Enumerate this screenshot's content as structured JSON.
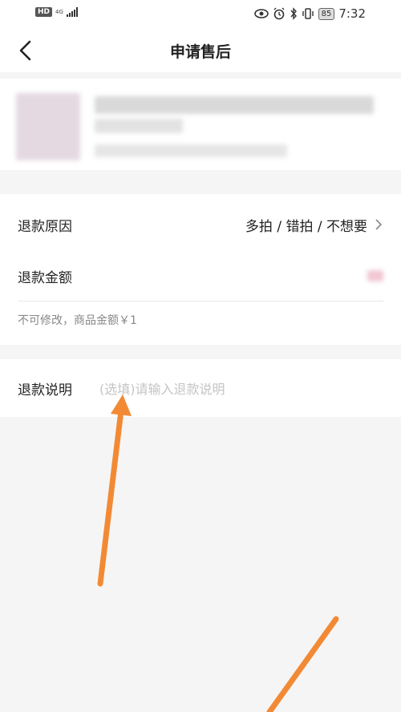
{
  "status_bar": {
    "hd": "HD",
    "network": "4G",
    "battery": "85",
    "time": "7:32"
  },
  "nav": {
    "title": "申请售后"
  },
  "refund": {
    "reason_label": "退款原因",
    "reason_value": "多拍 / 错拍 / 不想要",
    "amount_label": "退款金额",
    "amount_hint": "不可修改，商品金额￥1"
  },
  "explain": {
    "label": "退款说明",
    "placeholder": "(选填)请输入退款说明"
  },
  "colors": {
    "annotation_arrow": "#f28a35"
  }
}
